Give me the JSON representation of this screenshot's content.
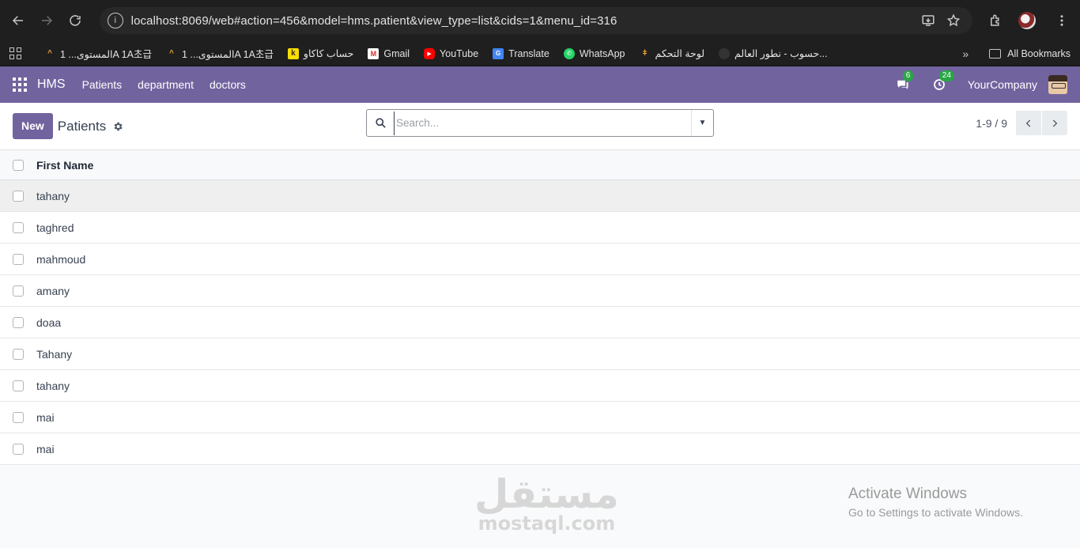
{
  "browser": {
    "url": "localhost:8069/web#action=456&model=hms.patient&view_type=list&cids=1&menu_id=316",
    "bookmarks": [
      {
        "label": "المستوى... 1A 1A초급",
        "icon": "anthropic-icon"
      },
      {
        "label": "المستوى... 1A 1A초급",
        "icon": "anthropic-icon"
      },
      {
        "label": "حساب كاكاو",
        "icon": "k-icon"
      },
      {
        "label": "Gmail",
        "icon": "gmail-icon"
      },
      {
        "label": "YouTube",
        "icon": "youtube-icon"
      },
      {
        "label": "Translate",
        "icon": "translate-icon"
      },
      {
        "label": "WhatsApp",
        "icon": "whatsapp-icon"
      },
      {
        "label": "لوحة التحكم",
        "icon": "dashboard-icon"
      },
      {
        "label": "حسوب - نطور العالم...",
        "icon": "hsoub-icon"
      }
    ],
    "all_bookmarks": "All Bookmarks"
  },
  "navbar": {
    "brand": "HMS",
    "menu": [
      "Patients",
      "department",
      "doctors"
    ],
    "messages_count": "6",
    "activities_count": "24",
    "company": "YourCompany"
  },
  "control_panel": {
    "new_label": "New",
    "title": "Patients",
    "search_placeholder": "Search...",
    "pager": "1-9 / 9"
  },
  "list": {
    "columns": [
      "First Name"
    ],
    "rows": [
      "tahany",
      "taghred",
      "mahmoud",
      "amany",
      "doaa",
      "Tahany",
      "tahany",
      "mai",
      "mai"
    ]
  },
  "watermark": {
    "arabic": "مستقل",
    "latin": "mostaql.com"
  },
  "windows_notice": {
    "title": "Activate Windows",
    "subtitle": "Go to Settings to activate Windows."
  }
}
